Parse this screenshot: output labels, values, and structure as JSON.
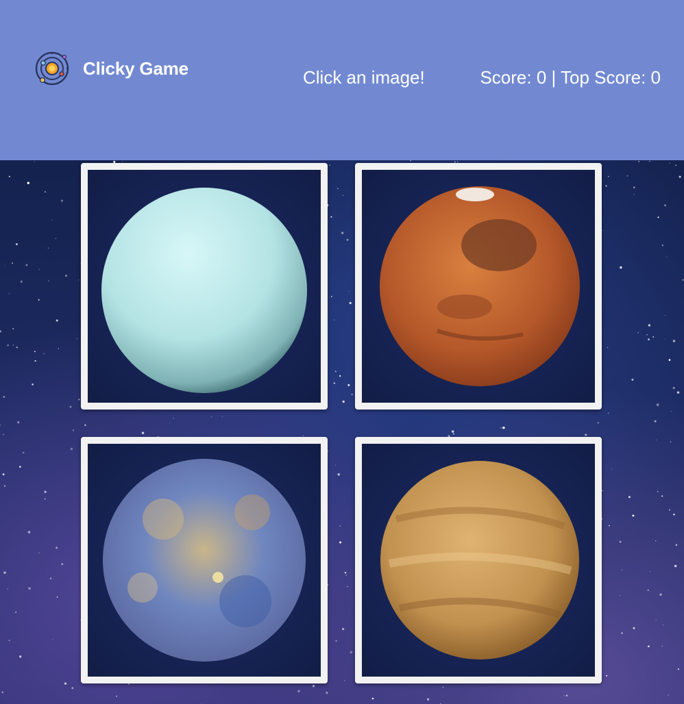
{
  "header": {
    "logo_icon": "solar-system-icon",
    "brand": "Clicky Game",
    "message": "Click an image!",
    "score_text": "Score: 0 | Top Score: 0",
    "background_color": "#7289d2"
  },
  "game": {
    "cards": [
      {
        "planet": "uranus-image",
        "color": "#bfe9ea"
      },
      {
        "planet": "mars-image",
        "color": "#c2602c"
      },
      {
        "planet": "mercury-image",
        "color": "#7d8fb8"
      },
      {
        "planet": "venus-image",
        "color": "#b78848"
      }
    ]
  }
}
